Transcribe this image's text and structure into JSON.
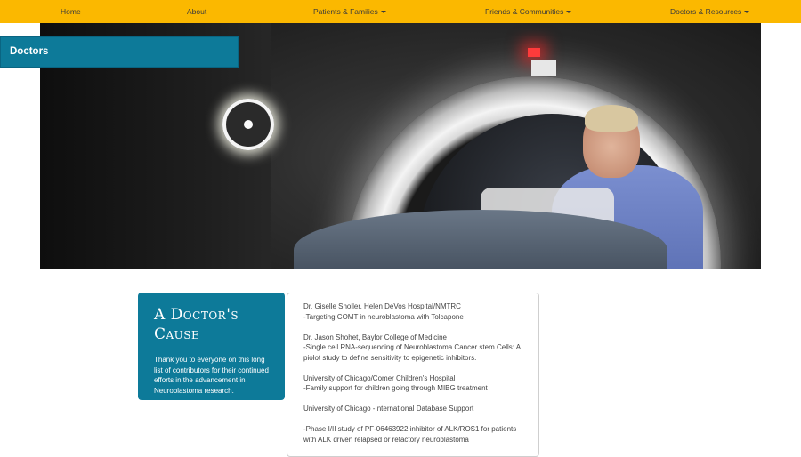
{
  "nav": {
    "items": [
      {
        "label": "Home",
        "dropdown": false
      },
      {
        "label": "About",
        "dropdown": false
      },
      {
        "label": "Patients & Families",
        "dropdown": true
      },
      {
        "label": "Friends & Communities",
        "dropdown": true
      },
      {
        "label": "Doctors & Resources",
        "dropdown": true
      }
    ]
  },
  "banner": {
    "title": "Doctors"
  },
  "cause": {
    "title": "A Doctor's Cause",
    "text": "Thank you to everyone on this long list of contributors for their continued efforts in the advancement in Neuroblastoma research."
  },
  "doctors": [
    {
      "lines": [
        "Dr. Giselle Sholler, Helen DeVos Hospital/NMTRC",
        "-Targeting COMT in neuroblastoma with Tolcapone"
      ]
    },
    {
      "lines": [
        "Dr. Jason Shohet, Baylor College of Medicine",
        "-Single cell RNA-sequencing of Neuroblastoma Cancer stem Cells: A",
        "piolot study to define sensitivity to epigenetic inhibitors."
      ]
    },
    {
      "lines": [
        "University of Chicago/Comer Children's Hospital",
        "-Family support for children going through MIBG treatment"
      ]
    },
    {
      "lines": [
        "University of Chicago -International Database Support"
      ]
    },
    {
      "lines": [
        "-Phase I/II study of PF-06463922 inhibitor of ALK/ROS1 for patients",
        "with ALK driven relapsed or refactory neuroblastoma"
      ]
    }
  ],
  "colors": {
    "nav_bg": "#fbb800",
    "accent_teal": "#0d7a99"
  }
}
